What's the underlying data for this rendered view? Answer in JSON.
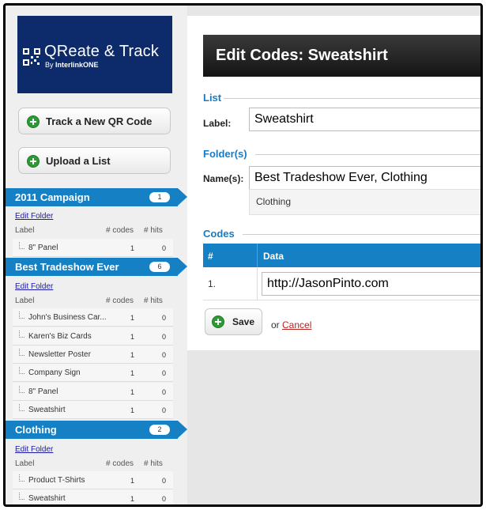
{
  "brand": {
    "title": "QReate & Track",
    "by": "By",
    "company": "InterlinkONE"
  },
  "sidebar": {
    "track_button": "Track a New QR Code",
    "upload_button": "Upload a List",
    "column_label": "Label",
    "column_codes": "# codes",
    "column_hits": "# hits",
    "edit_folder": "Edit Folder",
    "folders": [
      {
        "name": "2011 Campaign",
        "count": "1",
        "items": [
          {
            "label": "8\" Panel",
            "codes": "1",
            "hits": "0"
          }
        ]
      },
      {
        "name": "Best Tradeshow Ever",
        "count": "6",
        "items": [
          {
            "label": "John's Business Car...",
            "codes": "1",
            "hits": "0"
          },
          {
            "label": "Karen's Biz Cards",
            "codes": "1",
            "hits": "0"
          },
          {
            "label": "Newsletter Poster",
            "codes": "1",
            "hits": "0"
          },
          {
            "label": "Company Sign",
            "codes": "1",
            "hits": "0"
          },
          {
            "label": "8\" Panel",
            "codes": "1",
            "hits": "0"
          },
          {
            "label": "Sweatshirt",
            "codes": "1",
            "hits": "0"
          }
        ]
      },
      {
        "name": "Clothing",
        "count": "2",
        "items": [
          {
            "label": "Product T-Shirts",
            "codes": "1",
            "hits": "0"
          },
          {
            "label": "Sweatshirt",
            "codes": "1",
            "hits": "0"
          }
        ]
      }
    ]
  },
  "main": {
    "header": "Edit Codes: Sweatshirt",
    "list_legend": "List",
    "label_field_label": "Label:",
    "label_value": "Sweatshirt",
    "folders_legend": "Folder(s)",
    "names_field_label": "Name(s):",
    "names_value": "Best Tradeshow Ever, Clothing",
    "folder_tag": "Clothing",
    "codes_legend": "Codes",
    "codes_col_num": "#",
    "codes_col_data": "Data",
    "codes_rows": [
      {
        "index": "1.",
        "data": "http://JasonPinto.com"
      }
    ],
    "save_label": "Save",
    "or_text": "or",
    "cancel_label": "Cancel"
  },
  "colors": {
    "accent_blue": "#1580c4",
    "logo_navy": "#0d2b6b",
    "add_green": "#2d9a35",
    "cancel_red": "#c0201c"
  }
}
